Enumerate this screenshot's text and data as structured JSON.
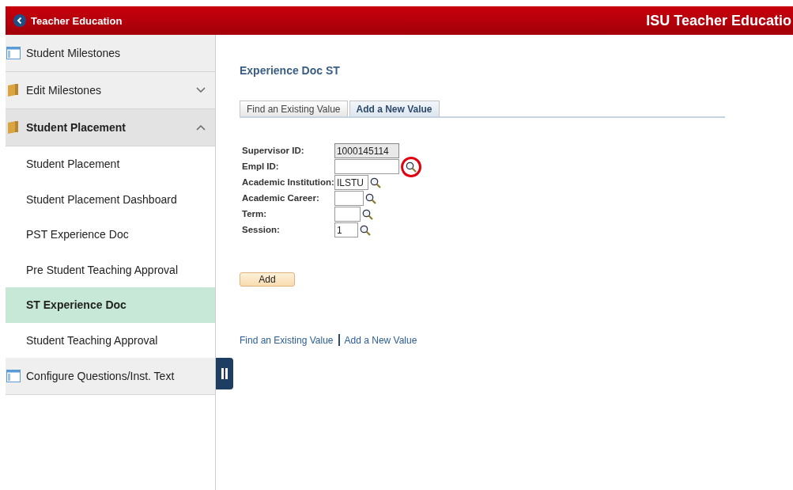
{
  "header": {
    "back_label": "Teacher Education",
    "title": "ISU Teacher Educatio"
  },
  "sidebar": {
    "items": [
      {
        "label": "Student Milestones",
        "kind": "page"
      },
      {
        "label": "Edit Milestones",
        "kind": "folder",
        "expanded": false
      },
      {
        "label": "Student Placement",
        "kind": "folder",
        "expanded": true,
        "children": [
          {
            "label": "Student Placement",
            "selected": false
          },
          {
            "label": "Student Placement Dashboard",
            "selected": false
          },
          {
            "label": "PST Experience Doc",
            "selected": false
          },
          {
            "label": "Pre Student Teaching Approval",
            "selected": false
          },
          {
            "label": "ST Experience Doc",
            "selected": true
          },
          {
            "label": "Student Teaching Approval",
            "selected": false
          }
        ]
      },
      {
        "label": "Configure Questions/Inst. Text",
        "kind": "page"
      }
    ]
  },
  "page_title": "Experience Doc ST",
  "tabs": [
    {
      "label": "Find an Existing Value",
      "selected": false
    },
    {
      "label": "Add a New Value",
      "selected": true
    }
  ],
  "fields": [
    {
      "label": "Supervisor ID:",
      "value": "1000145114",
      "disabled": true,
      "lookup": false,
      "circled": false
    },
    {
      "label": "Empl ID:",
      "disabled": false,
      "lookup": true,
      "circled": true
    },
    {
      "label": "Academic Institution:",
      "value": "ILSTU",
      "disabled": false,
      "lookup": true,
      "circled": false
    },
    {
      "label": "Academic Career:",
      "disabled": false,
      "lookup": true,
      "circled": false
    },
    {
      "label": "Term:",
      "disabled": false,
      "lookup": true,
      "circled": false
    },
    {
      "label": "Session:",
      "value": "1",
      "disabled": false,
      "lookup": true,
      "circled": false
    }
  ],
  "add_button": "Add",
  "bottom_links": [
    "Find an Existing Value",
    "Add a New Value"
  ]
}
